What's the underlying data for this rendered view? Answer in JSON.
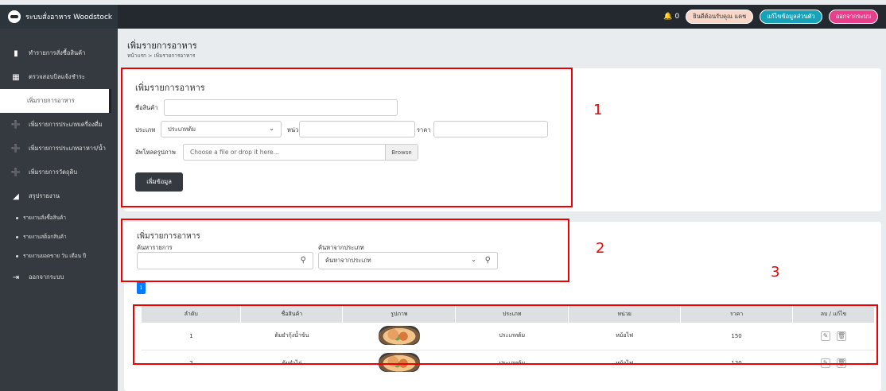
{
  "app": {
    "title": "ระบบสั่งอาหาร Woodstock"
  },
  "topbar": {
    "bell_count": "0",
    "welcome": "ยินดีต้อนรับคุณ แคช",
    "edit_profile": "แก้ไขข้อมูลส่วนตัว",
    "logout": "ออกจากระบบ",
    "colors": {
      "edit": "#17a2b8",
      "logout": "#e83e8c"
    }
  },
  "sidebar": {
    "items": [
      {
        "label": "ทำรายการสั่งซื้อสินค้า",
        "icon": "file-icon"
      },
      {
        "label": "ตรวจสอบบิลแจ้งชำระ",
        "icon": "grid-icon"
      },
      {
        "label": "เพิ่มรายการอาหาร",
        "icon": "",
        "active": true
      },
      {
        "label": "เพิ่มรายการประเภทเครื่องดื่ม",
        "icon": "plus-circle-icon"
      },
      {
        "label": "เพิ่มรายการประเภทอาหาร/น้ำ",
        "icon": "plus-circle-icon"
      },
      {
        "label": "เพิ่มรายการวัตถุดิบ",
        "icon": "plus-circle-icon"
      },
      {
        "label": "สรุปรายงาน",
        "icon": "report-icon"
      }
    ],
    "subitems": [
      "รายงานสั่งซื้อสินค้า",
      "รายงานสต็อกสินค้า",
      "รายงานยอดขาย วัน เดือน ปี"
    ],
    "logout": "ออกจากระบบ"
  },
  "page": {
    "title": "เพิ่มรายการอาหาร",
    "breadcrumb": "หน้าแรก > เพิ่มรายการอาหาร"
  },
  "form": {
    "title": "เพิ่มรายการอาหาร",
    "name_label": "ชื่อสินค้า",
    "type_label": "ประเภท",
    "type_value": "ประเภทต้ม",
    "unit_label": "หน่วย",
    "price_label": "ราคา",
    "image_label": "อัพโหลดรูปภาพ",
    "file_placeholder": "Choose a file or drop it here...",
    "browse": "Browse",
    "submit": "เพิ่มข้อมูล"
  },
  "search": {
    "title": "เพิ่มรายการอาหาร",
    "name_label": "ค้นหารายการ",
    "type_label": "ค้นหาจากประเภท",
    "type_placeholder": "ค้นหาจากประเภท"
  },
  "pagination": {
    "current": "1"
  },
  "table": {
    "headers": [
      "ลำดับ",
      "ชื่อสินค้า",
      "รูปภาพ",
      "ประเภท",
      "หน่วย",
      "ราคา",
      "ลบ / แก้ไข"
    ],
    "rows": [
      {
        "no": "1",
        "name": "ต้มยำกุ้งน้ำข้น",
        "type": "ประเภทต้ม",
        "unit": "หม้อไฟ",
        "price": "150"
      },
      {
        "no": "2",
        "name": "ต้มยำไก่",
        "type": "ประเภทต้ม",
        "unit": "หม้อไฟ",
        "price": "120"
      }
    ]
  },
  "annotations": {
    "n1": "1",
    "n2": "2",
    "n3": "3"
  }
}
